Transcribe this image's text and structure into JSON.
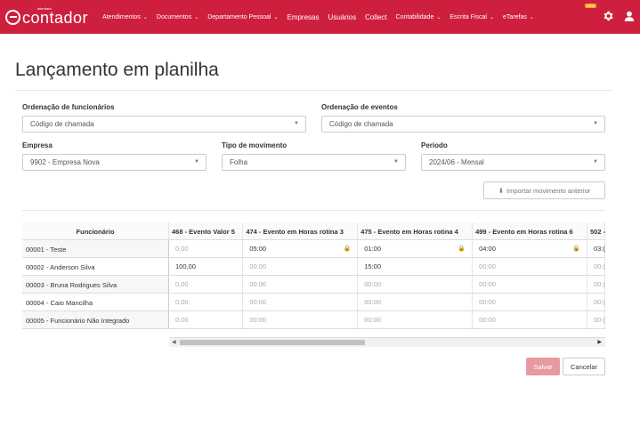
{
  "header": {
    "logo_text": "contador",
    "logo_sub": "alterdata",
    "nav": [
      {
        "label": "Atendimentos",
        "caret": true,
        "big": false
      },
      {
        "label": "Documentos",
        "caret": true,
        "big": false
      },
      {
        "label": "Departamento Pessoal",
        "caret": true,
        "big": false
      },
      {
        "label": "Empresas",
        "caret": false,
        "big": true
      },
      {
        "label": "Usuários",
        "caret": false,
        "big": true
      },
      {
        "label": "Collect",
        "caret": false,
        "big": true
      },
      {
        "label": "Contabilidade",
        "caret": true,
        "big": false
      },
      {
        "label": "Escrita Fiscal",
        "caret": true,
        "big": false
      },
      {
        "label": "eTarefas",
        "caret": true,
        "big": false
      }
    ],
    "etarefas_badge": "NEW"
  },
  "page": {
    "title": "Lançamento em planilha"
  },
  "filters": {
    "ordenacao_funcionarios": {
      "label": "Ordenação de funcionários",
      "value": "Código de chamada"
    },
    "ordenacao_eventos": {
      "label": "Ordenação de eventos",
      "value": "Código de chamada"
    },
    "empresa": {
      "label": "Empresa",
      "value": "9902 - Empresa Nova"
    },
    "tipo_movimento": {
      "label": "Tipo de movimento",
      "value": "Folha"
    },
    "periodo": {
      "label": "Período",
      "value": "2024/06 - Mensal"
    }
  },
  "import_button": "Importar movimento anterior",
  "grid": {
    "employee_header": "Funcionário",
    "columns": [
      "468 - Evento Valor 5",
      "474 - Evento em Horas rotina 3",
      "475 - Evento em Horas rotina 4",
      "499 - Evento em Horas rotina 6",
      "502 -"
    ],
    "rows": [
      {
        "employee": "00001 - Teste",
        "cells": [
          "0,00",
          "05:00",
          "01:00",
          "04:00",
          "03:("
        ],
        "editable": [
          false,
          true,
          true,
          true,
          true
        ],
        "locks": [
          false,
          true,
          true,
          true,
          false
        ]
      },
      {
        "employee": "00002 - Anderson Silva",
        "cells": [
          "100,00",
          "00:00",
          "15:00",
          "00:00",
          "00:("
        ],
        "editable": [
          true,
          false,
          true,
          false,
          false
        ],
        "locks": [
          false,
          false,
          false,
          false,
          false
        ]
      },
      {
        "employee": "00003 - Bruna Rodrigues Silva",
        "cells": [
          "0,00",
          "00:00",
          "00:00",
          "00:00",
          "00:("
        ],
        "editable": [
          false,
          false,
          false,
          false,
          false
        ],
        "locks": [
          false,
          false,
          false,
          false,
          false
        ]
      },
      {
        "employee": "00004 - Caio Mancilha",
        "cells": [
          "0,00",
          "00:00",
          "00:00",
          "00:00",
          "00:("
        ],
        "editable": [
          false,
          false,
          false,
          false,
          false
        ],
        "locks": [
          false,
          false,
          false,
          false,
          false
        ]
      },
      {
        "employee": "00005 - Funcionário Não Integrado",
        "cells": [
          "0,00",
          "00:00",
          "00:00",
          "00:00",
          "00:("
        ],
        "editable": [
          false,
          false,
          false,
          false,
          false
        ],
        "locks": [
          false,
          false,
          false,
          false,
          false
        ]
      }
    ]
  },
  "actions": {
    "save": "Salvar",
    "cancel": "Cancelar"
  },
  "colors": {
    "brand": "#ce1f3f",
    "save_disabled": "#e79aa2"
  }
}
